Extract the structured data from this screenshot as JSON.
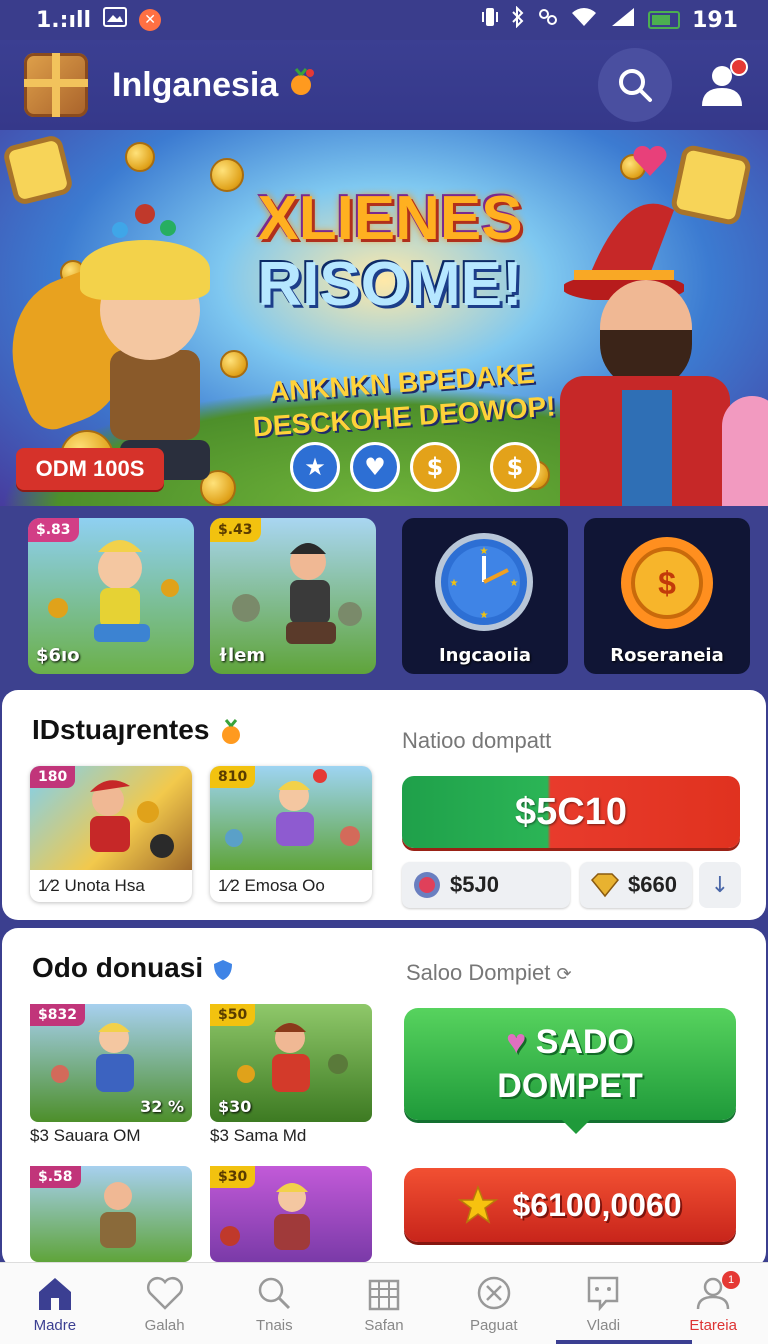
{
  "status_bar": {
    "signal_text": "1.:ıll",
    "time": "191"
  },
  "header": {
    "title": "Inlganesia"
  },
  "banner": {
    "title_line1": "XLIENES",
    "title_line2": "RISOME!",
    "subtitle_line1": "ANKNKN BPEDAKE",
    "subtitle_line2": "DESCKOHE DEOWOP!",
    "badge": "ODM 100S"
  },
  "tiles": [
    {
      "corner": "$.83",
      "label": "$6ıo"
    },
    {
      "corner": "$.43",
      "label": "ɫlem"
    },
    {
      "label": "Ingcaoıia"
    },
    {
      "label": "Roseraneia"
    }
  ],
  "section1": {
    "title": "IDstuaȷrentes",
    "subtitle": "Natioo dompatt",
    "games": [
      {
        "tag": "180",
        "name": "1⁄2 Unota Hsa"
      },
      {
        "tag": "810",
        "name": "1⁄2 Emosa Oo"
      }
    ],
    "amount": "$5C10",
    "chip1": "$5J0",
    "chip2": "$660"
  },
  "section2": {
    "title": "Odo donuasi",
    "subtitle": "Saloo Dompiet",
    "games": [
      {
        "tag": "$832",
        "right_tag": "32 %",
        "caption": "$3 Sauara OM"
      },
      {
        "tag": "$50",
        "bottom_tag": "$30",
        "caption": "$3 Sama Md"
      },
      {
        "tag": "$.58"
      },
      {
        "tag": "$30"
      }
    ],
    "green_button_line1": "SADO",
    "green_button_line2": "DOMPET",
    "red_button": "$6100,0060"
  },
  "bottom_nav": [
    {
      "label": "Madre",
      "icon": "home-icon"
    },
    {
      "label": "Galah",
      "icon": "heart-icon"
    },
    {
      "label": "Tnais",
      "icon": "search-icon"
    },
    {
      "label": "Safan",
      "icon": "building-icon"
    },
    {
      "label": "Paguat",
      "icon": "close-circle-icon"
    },
    {
      "label": "Vladi",
      "icon": "chat-icon"
    },
    {
      "label": "Etareia",
      "icon": "user-icon",
      "badge": "1"
    }
  ],
  "colors": {
    "primary": "#3b3f92",
    "green": "#1fa04a",
    "red": "#e0321f",
    "accent": "#f2c20f"
  }
}
